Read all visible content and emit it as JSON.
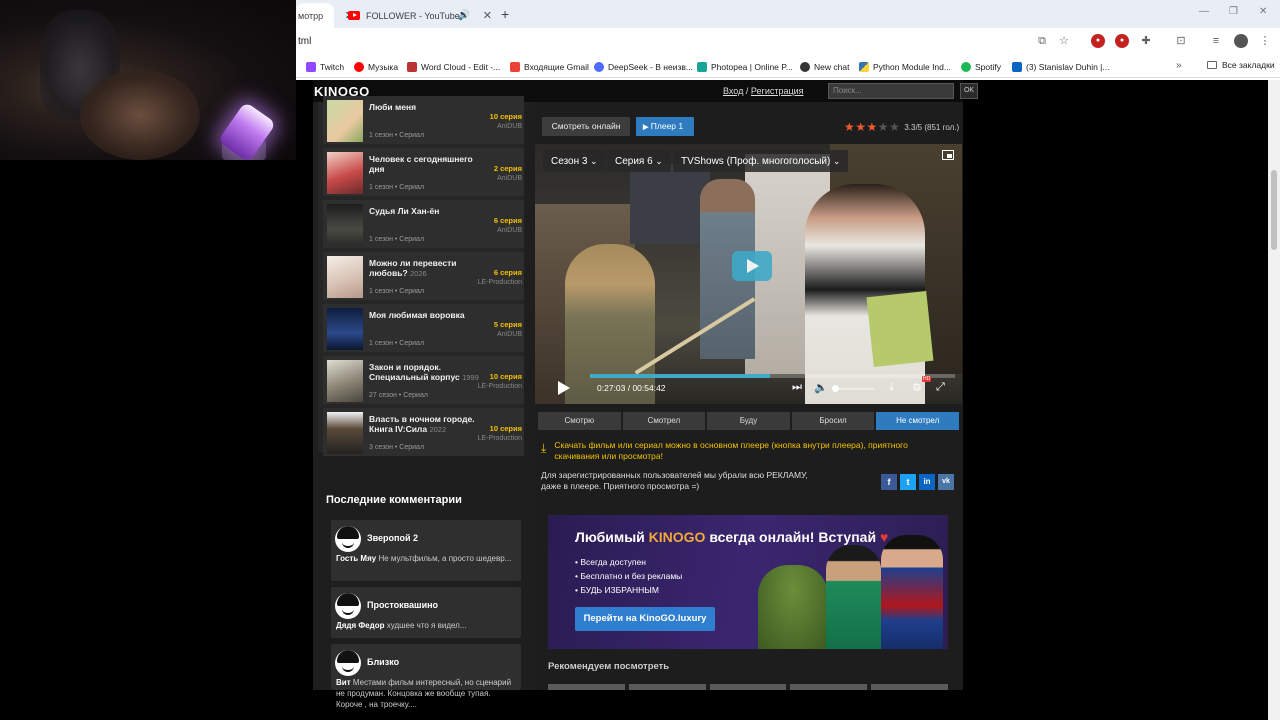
{
  "browser": {
    "tabs": [
      {
        "label": "мотрр"
      },
      {
        "label": "FOLLOWER - YouTube"
      }
    ],
    "url": "tml",
    "bookmarks": [
      {
        "label": "Twitch",
        "color": "#9146ff"
      },
      {
        "label": "Музыка",
        "color": "#ff0000"
      },
      {
        "label": "Word Cloud - Edit -...",
        "color": "#b33"
      },
      {
        "label": "Входящие Gmail",
        "color": "#ea4335"
      },
      {
        "label": "DeepSeek - В неизв...",
        "color": "#4d6bfe"
      },
      {
        "label": "Photopea | Online P...",
        "color": "#18a497"
      },
      {
        "label": "New chat",
        "color": "#333333"
      },
      {
        "label": "Python Module Ind...",
        "color": "#3776ab"
      },
      {
        "label": "Spotify",
        "color": "#1db954"
      },
      {
        "label": "(3) Stanislav Duhin |...",
        "color": "#0a66c2"
      }
    ],
    "all_bookmarks": "Все закладки"
  },
  "site": {
    "logo": "KINOGO",
    "login": "Вход",
    "separator": "/",
    "register": "Регистрация",
    "search_placeholder": "Поиск...",
    "search_button": "OK"
  },
  "sidebar": {
    "items": [
      {
        "title": "Люби меня",
        "year": "",
        "meta": "1 сезон  •  Сериал",
        "episode": "10 серия",
        "studio": "AniDUB"
      },
      {
        "title": "Человек с сегодняшнего дня",
        "year": "",
        "meta": "1 сезон  •  Сериал",
        "episode": "2 серия",
        "studio": "AniDUB"
      },
      {
        "title": "Судья Ли Хан-ён",
        "year": "",
        "meta": "1 сезон  •  Сериал",
        "episode": "6 серия",
        "studio": "AniDUB"
      },
      {
        "title": "Можно ли перевести любовь?",
        "year": "2026",
        "meta": "1 сезон  •  Сериал",
        "episode": "6 серия",
        "studio": "LE-Production"
      },
      {
        "title": "Моя любимая воровка",
        "year": "",
        "meta": "1 сезон  •  Сериал",
        "episode": "5 серия",
        "studio": "AniDUB"
      },
      {
        "title": "Закон и порядок. Специальный корпус",
        "year": "1999",
        "meta": "27 сезон  •  Сериал",
        "episode": "10 серия",
        "studio": "LE-Production"
      },
      {
        "title": "Власть в ночном городе. Книга IV:Сила",
        "year": "2022",
        "meta": "3 сезон  •  Сериал",
        "episode": "10 серия",
        "studio": "LE-Production"
      }
    ],
    "comments_title": "Последние комментарии",
    "comments": [
      {
        "title": "Зверопой 2",
        "author": "Гость Мяу",
        "text": "Не мультфильм, а просто шедевр..."
      },
      {
        "title": "Простоквашино",
        "author": "Дядя Федор",
        "text": "худшее что я видел..."
      },
      {
        "title": "Близко",
        "author": "Вит",
        "text": "Местами фильм интересный, но сценарий не продуман. Концовка же вообще тупая. Короче , на троечку...."
      }
    ]
  },
  "player": {
    "watch_online": "Смотреть онлайн",
    "player_tab": "Плеер 1",
    "rating_text": "3.3/5 (851 гол.)",
    "rating_value": 3.3,
    "season": "Сезон 3",
    "episode": "Серия 6",
    "voice": "TVShows (Проф. многоголосый)",
    "time": "0:27:03 / 00:54:42",
    "progress": 0.494,
    "volume": 0.0,
    "accent_color": "#3fa9c9",
    "status_tabs": [
      "Смотрю",
      "Смотрел",
      "Буду",
      "Бросил",
      "Не смотрел"
    ],
    "active_status": "Не смотрел"
  },
  "notes": {
    "download": "Скачать фильм или сериал можно в основном плеере (кнопка внутри плеера), приятного скачивания или просмотра!",
    "registered": "Для зарегистрированных пользователей мы убрали всю РЕКЛАМУ, даже в плеере. Приятного просмотра =)",
    "social": [
      "f",
      "t",
      "in",
      "vk"
    ]
  },
  "banner": {
    "title_pre": "Любимый ",
    "title_brand": "KINOGO",
    "title_post": " всегда онлайн! Вступай ",
    "heart": "♥",
    "bullets": [
      "Всегда доступен",
      "Бесплатно и без рекламы",
      "БУДЬ ИЗБРАННЫМ"
    ],
    "button": "Перейти на KinoGO.luxury"
  },
  "recommend_title": "Рекомендуем посмотреть"
}
